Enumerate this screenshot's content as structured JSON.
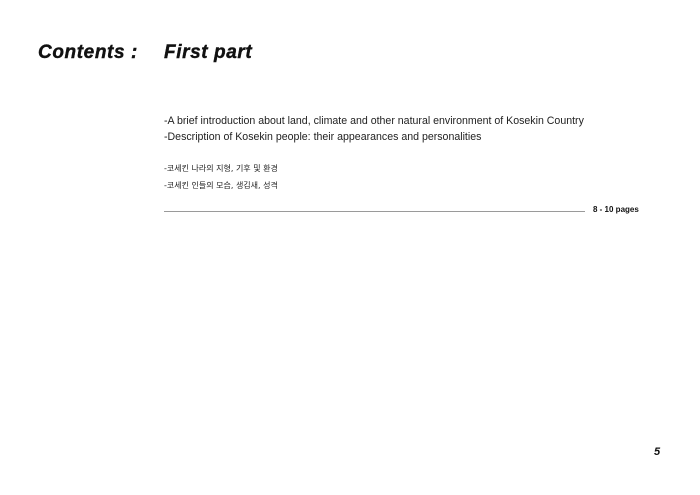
{
  "header": {
    "section_label": "Contents :",
    "part_title": "First part"
  },
  "descriptions": [
    "-A brief introduction about land, climate and other natural environment of Kosekin Country",
    "-Description of Kosekin people: their appearances and personalities"
  ],
  "korean_descriptions": [
    "-코세킨 나라의 지형, 기후 및 환경",
    "-코세킨 인들의 모습, 생김새, 성격"
  ],
  "page_range": "8 - 10 pages",
  "page_number": "5"
}
